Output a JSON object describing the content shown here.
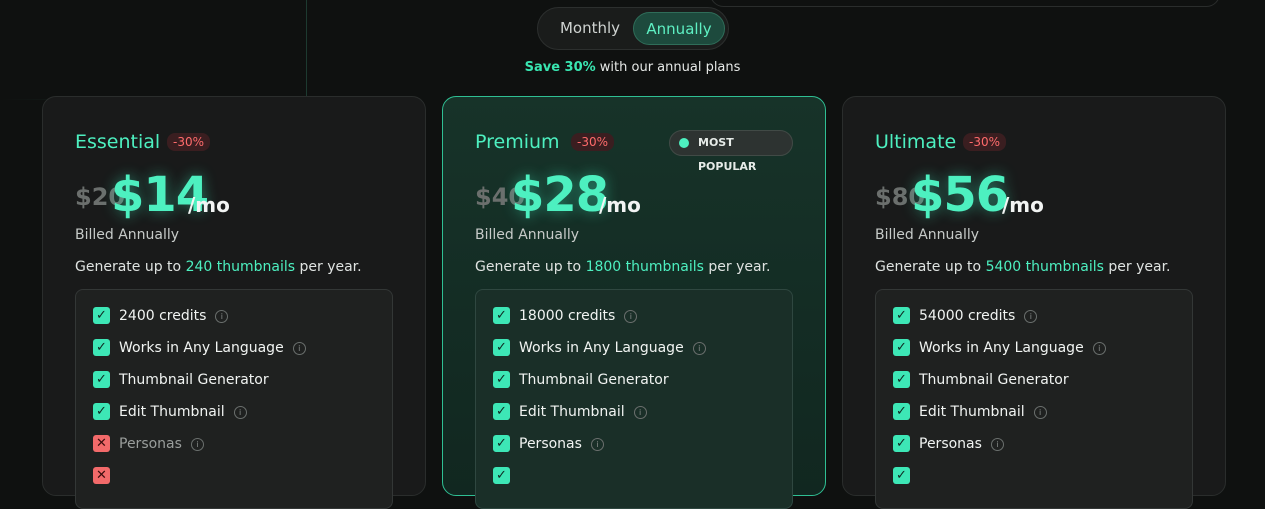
{
  "billing_toggle": {
    "monthly": "Monthly",
    "annually": "Annually"
  },
  "save_note": {
    "highlight": "Save 30%",
    "rest": " with our annual plans"
  },
  "plans": [
    {
      "name": "Essential",
      "discount": "-30%",
      "old_price": "$20",
      "price": "$14",
      "per": "/mo",
      "billed": "Billed Annually",
      "generate": {
        "pre": "Generate up to ",
        "highlight": "240 thumbnails",
        "post": " per year."
      },
      "features": [
        {
          "label": "2400 credits",
          "included": true,
          "info": true
        },
        {
          "label": "Works in Any Language",
          "included": true,
          "info": true
        },
        {
          "label": "Thumbnail Generator",
          "included": true,
          "info": false
        },
        {
          "label": "Edit Thumbnail",
          "included": true,
          "info": true
        },
        {
          "label": "Personas",
          "included": false,
          "info": true
        }
      ]
    },
    {
      "name": "Premium",
      "discount": "-30%",
      "badge": "MOST POPULAR",
      "old_price": "$40",
      "price": "$28",
      "per": "/mo",
      "billed": "Billed Annually",
      "generate": {
        "pre": "Generate up to ",
        "highlight": "1800 thumbnails",
        "post": " per year."
      },
      "features": [
        {
          "label": "18000 credits",
          "included": true,
          "info": true
        },
        {
          "label": "Works in Any Language",
          "included": true,
          "info": true
        },
        {
          "label": "Thumbnail Generator",
          "included": true,
          "info": false
        },
        {
          "label": "Edit Thumbnail",
          "included": true,
          "info": true
        },
        {
          "label": "Personas",
          "included": true,
          "info": true
        }
      ]
    },
    {
      "name": "Ultimate",
      "discount": "-30%",
      "old_price": "$80",
      "price": "$56",
      "per": "/mo",
      "billed": "Billed Annually",
      "generate": {
        "pre": "Generate up to ",
        "highlight": "5400 thumbnails",
        "post": " per year."
      },
      "features": [
        {
          "label": "54000 credits",
          "included": true,
          "info": true
        },
        {
          "label": "Works in Any Language",
          "included": true,
          "info": true
        },
        {
          "label": "Thumbnail Generator",
          "included": true,
          "info": false
        },
        {
          "label": "Edit Thumbnail",
          "included": true,
          "info": true
        },
        {
          "label": "Personas",
          "included": true,
          "info": true
        }
      ]
    }
  ],
  "colors": {
    "accent": "#4df0c0",
    "discount": "#ff6b6b",
    "background": "#0f1110"
  }
}
